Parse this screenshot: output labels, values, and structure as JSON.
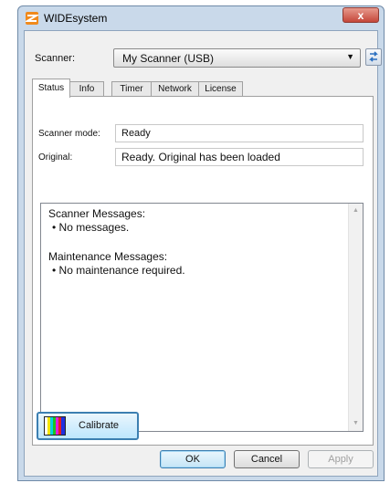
{
  "window": {
    "title": "WIDEsystem",
    "close_label": "x"
  },
  "scanner": {
    "label": "Scanner:",
    "selected": "My Scanner (USB)"
  },
  "tabs": [
    {
      "label": "Status",
      "active": true
    },
    {
      "label": "Info"
    },
    {
      "label": "Timer"
    },
    {
      "label": "Network"
    },
    {
      "label": "License"
    }
  ],
  "status": {
    "scanner_mode_label": "Scanner mode:",
    "scanner_mode_value": "Ready",
    "original_label": "Original:",
    "original_value": "Ready. Original has been loaded"
  },
  "messages": {
    "scanner_heading": "Scanner Messages:",
    "scanner_item": "• No messages.",
    "maintenance_heading": "Maintenance Messages:",
    "maintenance_item": "• No maintenance required."
  },
  "calibrate_label": "Calibrate",
  "buttons": {
    "ok": "OK",
    "cancel": "Cancel",
    "apply": "Apply"
  },
  "colors": {
    "titlebar": "#c9d9ea",
    "accent_border": "#3c7fb1",
    "close": "#c5473a"
  }
}
